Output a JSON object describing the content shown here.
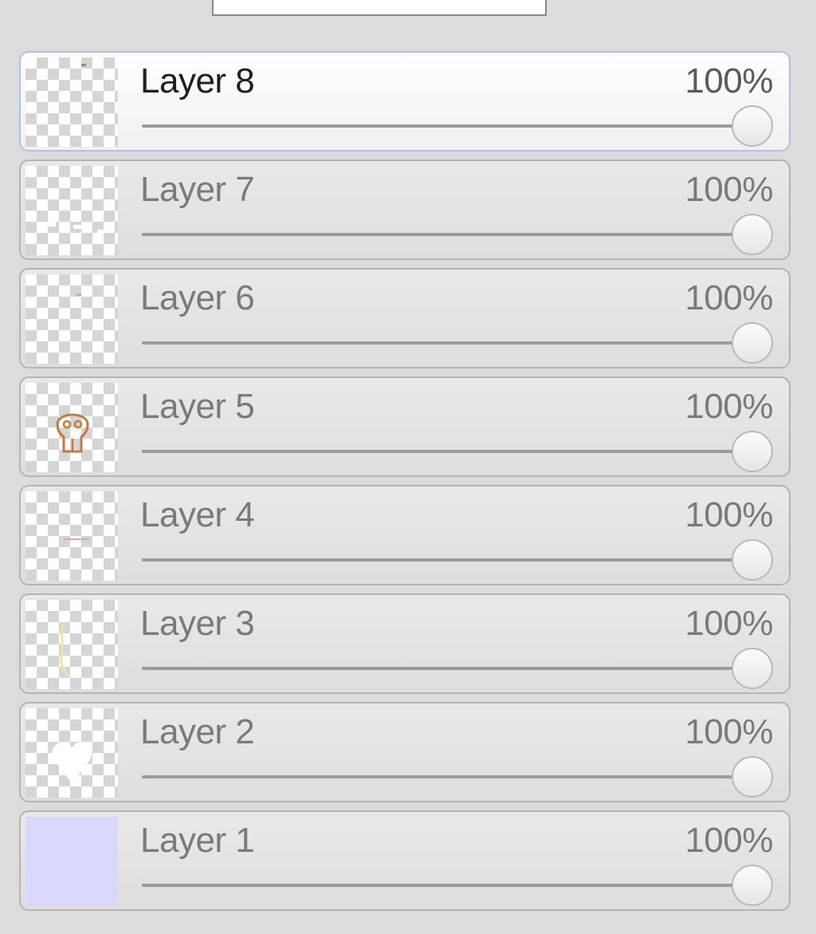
{
  "colors": {
    "panel_bg": "#dcdcdc",
    "selected_border": "#a9c3ea",
    "layer1_fill": "#d8d9fa",
    "layer5_skull": "#c47a3a"
  },
  "layers": [
    {
      "name": "Layer 8",
      "opacity_label": "100%",
      "opacity": 1.0,
      "selected": true,
      "thumb": "transparent"
    },
    {
      "name": "Layer 7",
      "opacity_label": "100%",
      "opacity": 1.0,
      "selected": false,
      "thumb": "white-specks"
    },
    {
      "name": "Layer 6",
      "opacity_label": "100%",
      "opacity": 1.0,
      "selected": false,
      "thumb": "green-speck"
    },
    {
      "name": "Layer 5",
      "opacity_label": "100%",
      "opacity": 1.0,
      "selected": false,
      "thumb": "skull-icon"
    },
    {
      "name": "Layer 4",
      "opacity_label": "100%",
      "opacity": 1.0,
      "selected": false,
      "thumb": "pink-line"
    },
    {
      "name": "Layer 3",
      "opacity_label": "100%",
      "opacity": 1.0,
      "selected": false,
      "thumb": "yellow-stroke"
    },
    {
      "name": "Layer 2",
      "opacity_label": "100%",
      "opacity": 1.0,
      "selected": false,
      "thumb": "white-heart"
    },
    {
      "name": "Layer 1",
      "opacity_label": "100%",
      "opacity": 1.0,
      "selected": false,
      "thumb": "solid-lavender"
    }
  ]
}
